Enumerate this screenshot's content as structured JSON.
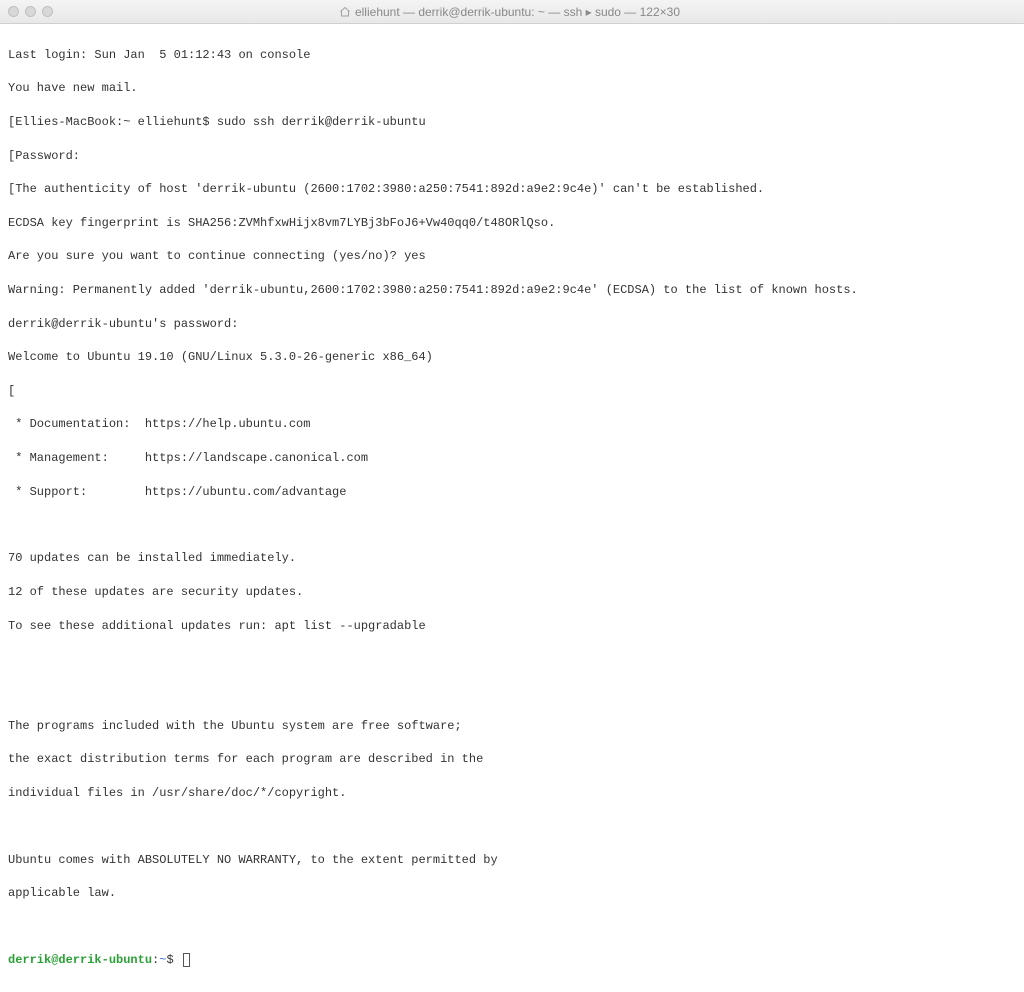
{
  "window": {
    "title": "elliehunt — derrik@derrik-ubuntu: ~ — ssh ▸ sudo — 122×30"
  },
  "terminal": {
    "lines": [
      "Last login: Sun Jan  5 01:12:43 on console",
      "You have new mail.",
      "[Ellies-MacBook:~ elliehunt$ sudo ssh derrik@derrik-ubuntu",
      "[Password:",
      "[The authenticity of host 'derrik-ubuntu (2600:1702:3980:a250:7541:892d:a9e2:9c4e)' can't be established.",
      "ECDSA key fingerprint is SHA256:ZVMhfxwHijx8vm7LYBj3bFoJ6+Vw40qq0/t48ORlQso.",
      "Are you sure you want to continue connecting (yes/no)? yes",
      "Warning: Permanently added 'derrik-ubuntu,2600:1702:3980:a250:7541:892d:a9e2:9c4e' (ECDSA) to the list of known hosts.",
      "derrik@derrik-ubuntu's password:",
      "Welcome to Ubuntu 19.10 (GNU/Linux 5.3.0-26-generic x86_64)",
      "[",
      " * Documentation:  https://help.ubuntu.com",
      " * Management:     https://landscape.canonical.com",
      " * Support:        https://ubuntu.com/advantage",
      "",
      "70 updates can be installed immediately.",
      "12 of these updates are security updates.",
      "To see these additional updates run: apt list --upgradable",
      "",
      "",
      "The programs included with the Ubuntu system are free software;",
      "the exact distribution terms for each program are described in the",
      "individual files in /usr/share/doc/*/copyright.",
      "",
      "Ubuntu comes with ABSOLUTELY NO WARRANTY, to the extent permitted by",
      "applicable law.",
      ""
    ],
    "prompt_user_host": "derrik@derrik-ubuntu",
    "prompt_colon": ":",
    "prompt_path": "~",
    "prompt_dollar": "$"
  }
}
